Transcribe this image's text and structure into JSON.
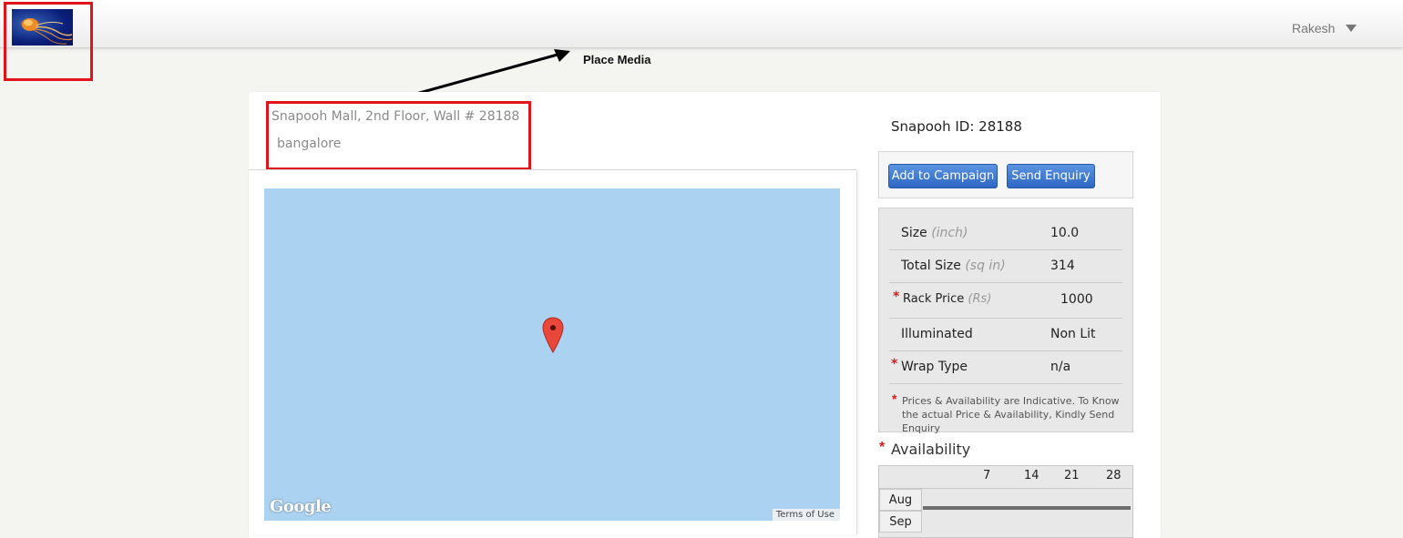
{
  "header": {
    "user_name": "Rakesh",
    "logo_icon": "jellyfish-logo-icon"
  },
  "annotation": {
    "label": "Place Media",
    "highlight_color": "#e0141b"
  },
  "listing": {
    "address_line1": "Snapooh Mall, 2nd Floor, Wall # 28188",
    "address_line2": "bangalore",
    "snapooh_id": "Snapooh ID: 28188"
  },
  "map": {
    "provider_label": "Google",
    "terms_label": "Terms of Use",
    "water_color": "#abd2f0",
    "marker_icon": "map-pin-icon"
  },
  "actions": {
    "add_to_campaign": "Add to Campaign",
    "send_enquiry": "Send Enquiry",
    "button_color": "#2d67c4"
  },
  "specs": [
    {
      "label": "Size",
      "unit": "(inch)",
      "value": "10.0",
      "required": false
    },
    {
      "label": "Total Size",
      "unit": "(sq in)",
      "value": "314",
      "required": false
    },
    {
      "label": "Rack Price",
      "unit": "(Rs)",
      "value": "1000",
      "required": true
    },
    {
      "label": "Illuminated",
      "unit": "",
      "value": "Non Lit",
      "required": false
    },
    {
      "label": "Wrap Type",
      "unit": "",
      "value": "n/a",
      "required": true
    }
  ],
  "note": "Prices & Availability are Indicative. To Know the actual Price & Availability, Kindly Send Enquiry",
  "required_mark": "*",
  "availability": {
    "title": "Availability",
    "days": [
      "7",
      "14",
      "21",
      "28"
    ],
    "months": [
      "Aug",
      "Sep"
    ]
  }
}
